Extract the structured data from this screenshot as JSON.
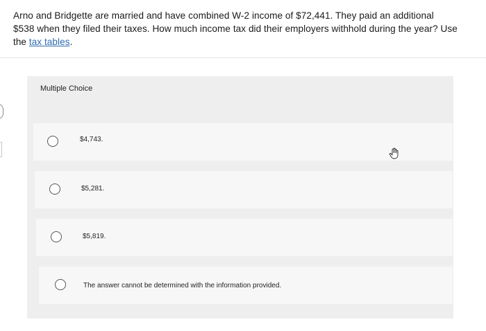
{
  "question": {
    "text": "Arno and Bridgette are married and have combined W-2 income of $72,441. They paid an additional $538 when they filed their taxes. How much income tax did their employers withhold during the year? Use the ",
    "link_text": "tax tables",
    "link_suffix": "."
  },
  "multiple_choice": {
    "label": "Multiple Choice",
    "options": [
      {
        "text": "$4,743."
      },
      {
        "text": "$5,281."
      },
      {
        "text": "$5,819."
      },
      {
        "text": "The answer cannot be determined with the information provided."
      }
    ]
  },
  "icons": {
    "radio": "radio-unselected-icon",
    "cursor": "hand-pointer-icon"
  },
  "colors": {
    "link": "#2d6bb0",
    "panel": "#eeeeee",
    "option_bg": "#f7f7f7"
  }
}
